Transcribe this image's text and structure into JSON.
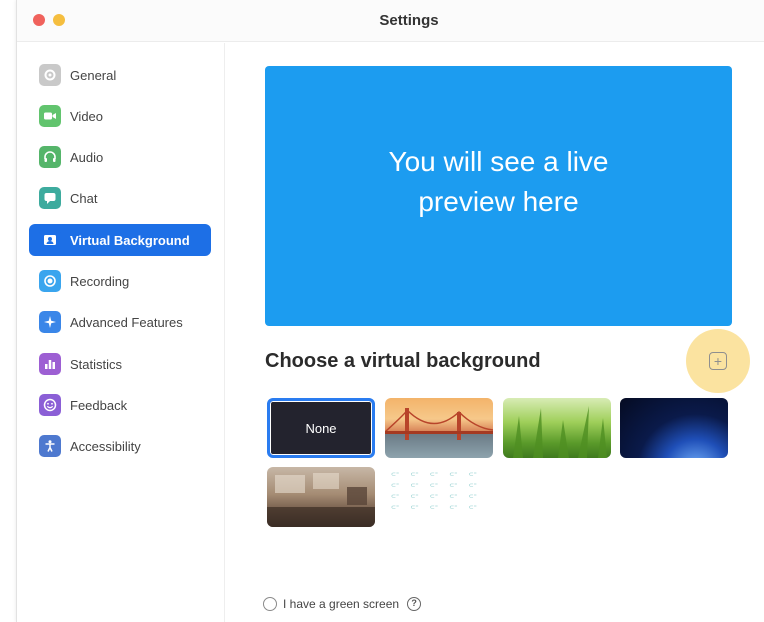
{
  "window": {
    "title": "Settings"
  },
  "sidebar": {
    "items": [
      {
        "label": "General",
        "icon": "gear-icon",
        "color": "#c9c9c9",
        "active": false
      },
      {
        "label": "Video",
        "icon": "video-icon",
        "color": "#62c46e",
        "active": false
      },
      {
        "label": "Audio",
        "icon": "headphones-icon",
        "color": "#55b56a",
        "active": false
      },
      {
        "label": "Chat",
        "icon": "chat-icon",
        "color": "#3dab9e",
        "active": false
      },
      {
        "label": "Virtual Background",
        "icon": "person-card-icon",
        "color": "#1d6fe6",
        "active": true
      },
      {
        "label": "Recording",
        "icon": "record-icon",
        "color": "#3aa5ee",
        "active": false
      },
      {
        "label": "Advanced Features",
        "icon": "sparkle-icon",
        "color": "#3a86e8",
        "active": false
      },
      {
        "label": "Statistics",
        "icon": "bar-chart-icon",
        "color": "#9d5fd3",
        "active": false
      },
      {
        "label": "Feedback",
        "icon": "smile-icon",
        "color": "#8b5fd6",
        "active": false
      },
      {
        "label": "Accessibility",
        "icon": "accessibility-icon",
        "color": "#4e79cf",
        "active": false
      }
    ]
  },
  "preview": {
    "text_line1": "You will see a live",
    "text_line2": "preview here",
    "color": "#1c9cf0"
  },
  "backgrounds": {
    "heading": "Choose a virtual background",
    "add_icon": "plus-square-icon",
    "items": [
      {
        "label": "None",
        "selected": true
      },
      {
        "label": "Golden Gate Bridge"
      },
      {
        "label": "Grass"
      },
      {
        "label": "Earth from space"
      },
      {
        "label": "Office"
      },
      {
        "label": "Zoom pattern"
      }
    ]
  },
  "green_screen": {
    "label": "I have a green screen",
    "checked": false,
    "help_icon": "help-circle-icon"
  },
  "accent_color": "#1d6fe6"
}
